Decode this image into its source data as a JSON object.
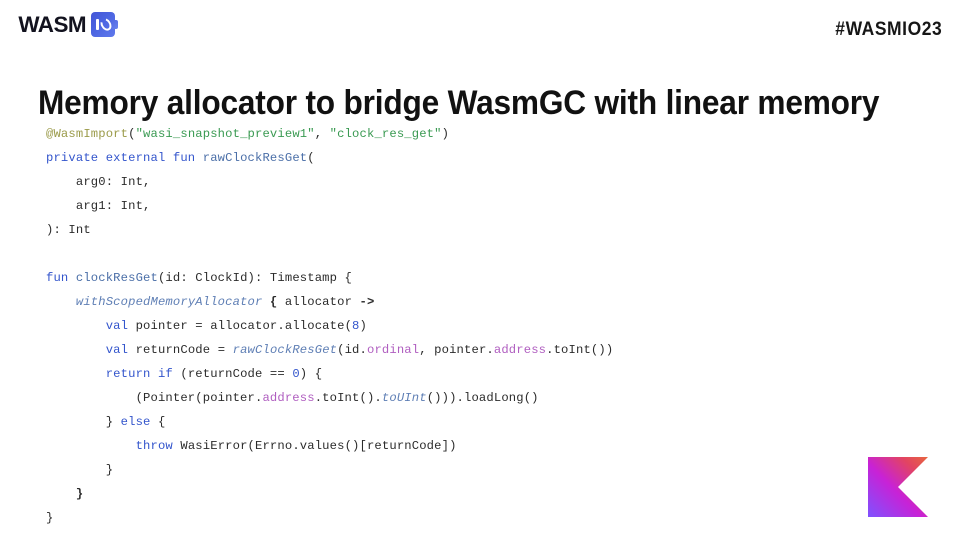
{
  "header": {
    "brand_word": "WASM",
    "brand_mark_icon": "wasmio-logo-icon",
    "hashtag": "#WASMIO23"
  },
  "title": "Memory allocator to bridge WasmGC with linear memory",
  "footer": {
    "kotlin_logo_icon": "kotlin-logo-icon"
  },
  "colors": {
    "background": "#ffffff",
    "title_text": "#111111",
    "keyword": "#3355cc",
    "annotation": "#9b9b4a",
    "string": "#3a9a52",
    "declaration": "#4b6fa8",
    "function_italic": "#5f7fb5",
    "property": "#b05ec0",
    "number": "#3355cc",
    "plain_code": "#2b2b2b",
    "brand_blue": "#4a63e0",
    "kotlin_gradient_start": "#7f52ff",
    "kotlin_gradient_mid": "#e24462",
    "kotlin_gradient_end": "#e44857"
  },
  "code": {
    "language": "kotlin",
    "lines": [
      [
        {
          "t": "@WasmImport",
          "c": "t-anno"
        },
        {
          "t": "(",
          "c": "t-plain"
        },
        {
          "t": "\"wasi_snapshot_preview1\"",
          "c": "t-str"
        },
        {
          "t": ", ",
          "c": "t-plain"
        },
        {
          "t": "\"clock_res_get\"",
          "c": "t-str"
        },
        {
          "t": ")",
          "c": "t-plain"
        }
      ],
      [
        {
          "t": "private external fun ",
          "c": "t-kw"
        },
        {
          "t": "rawClockResGet",
          "c": "t-decl"
        },
        {
          "t": "(",
          "c": "t-plain"
        }
      ],
      [
        {
          "t": "    arg0: Int,",
          "c": "t-plain"
        }
      ],
      [
        {
          "t": "    arg1: Int,",
          "c": "t-plain"
        }
      ],
      [
        {
          "t": "): Int",
          "c": "t-plain"
        }
      ],
      [],
      [
        {
          "t": "fun ",
          "c": "t-kw"
        },
        {
          "t": "clockResGet",
          "c": "t-decl"
        },
        {
          "t": "(id: ClockId): Timestamp {",
          "c": "t-plain"
        }
      ],
      [
        {
          "t": "    ",
          "c": "t-plain"
        },
        {
          "t": "withScopedMemoryAllocator",
          "c": "t-fnit"
        },
        {
          "t": " ",
          "c": "t-plain"
        },
        {
          "t": "{",
          "c": "t-bold"
        },
        {
          "t": " allocator ",
          "c": "t-plain"
        },
        {
          "t": "->",
          "c": "t-bold"
        }
      ],
      [
        {
          "t": "        ",
          "c": "t-plain"
        },
        {
          "t": "val",
          "c": "t-kw"
        },
        {
          "t": " pointer = allocator.allocate(",
          "c": "t-plain"
        },
        {
          "t": "8",
          "c": "t-num"
        },
        {
          "t": ")",
          "c": "t-plain"
        }
      ],
      [
        {
          "t": "        ",
          "c": "t-plain"
        },
        {
          "t": "val",
          "c": "t-kw"
        },
        {
          "t": " returnCode = ",
          "c": "t-plain"
        },
        {
          "t": "rawClockResGet",
          "c": "t-fnit"
        },
        {
          "t": "(id.",
          "c": "t-plain"
        },
        {
          "t": "ordinal",
          "c": "t-prop"
        },
        {
          "t": ", pointer.",
          "c": "t-plain"
        },
        {
          "t": "address",
          "c": "t-prop"
        },
        {
          "t": ".toInt())",
          "c": "t-plain"
        }
      ],
      [
        {
          "t": "        ",
          "c": "t-plain"
        },
        {
          "t": "return if",
          "c": "t-kw"
        },
        {
          "t": " (returnCode == ",
          "c": "t-plain"
        },
        {
          "t": "0",
          "c": "t-num"
        },
        {
          "t": ") {",
          "c": "t-plain"
        }
      ],
      [
        {
          "t": "            (Pointer(pointer.",
          "c": "t-plain"
        },
        {
          "t": "address",
          "c": "t-prop"
        },
        {
          "t": ".toInt().",
          "c": "t-plain"
        },
        {
          "t": "toUInt",
          "c": "t-fnit"
        },
        {
          "t": "())).loadLong()",
          "c": "t-plain"
        }
      ],
      [
        {
          "t": "        } ",
          "c": "t-plain"
        },
        {
          "t": "else",
          "c": "t-kw"
        },
        {
          "t": " {",
          "c": "t-plain"
        }
      ],
      [
        {
          "t": "            ",
          "c": "t-plain"
        },
        {
          "t": "throw",
          "c": "t-kw"
        },
        {
          "t": " WasiError(Errno.values()[returnCode])",
          "c": "t-plain"
        }
      ],
      [
        {
          "t": "        }",
          "c": "t-plain"
        }
      ],
      [
        {
          "t": "    ",
          "c": "t-plain"
        },
        {
          "t": "}",
          "c": "t-bold"
        }
      ],
      [
        {
          "t": "}",
          "c": "t-plain"
        }
      ]
    ]
  }
}
